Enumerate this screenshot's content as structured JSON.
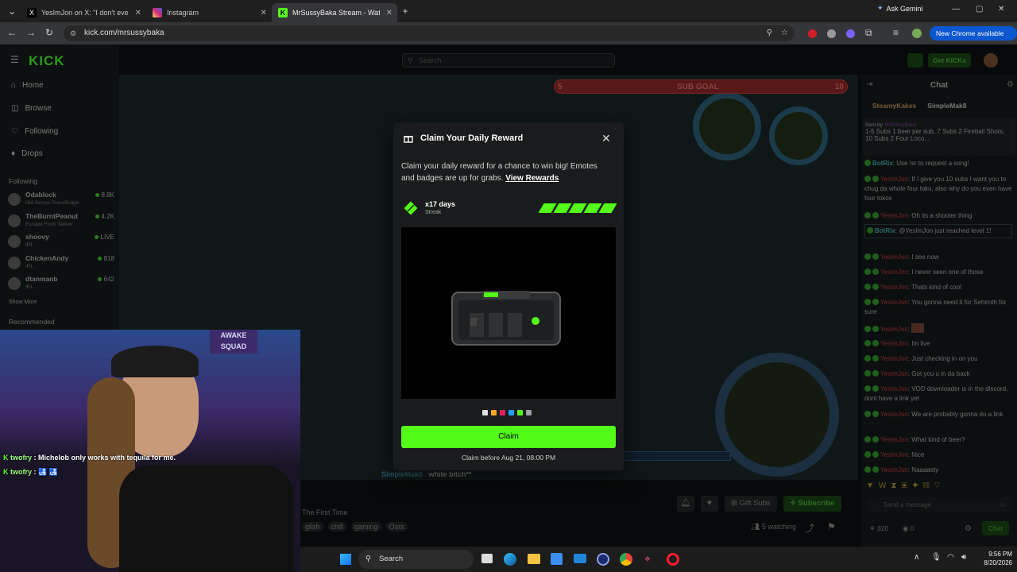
{
  "browser": {
    "tabs": [
      {
        "title": "YesImJon on X: \"I don't even be",
        "favicon": "x-icon",
        "color": "#000000"
      },
      {
        "title": "Instagram",
        "favicon": "instagram-icon",
        "color": "#d62976"
      },
      {
        "title": "MrSussyBaka Stream - Watch L",
        "favicon": "kick-icon",
        "color": "#53fc18"
      }
    ],
    "ask_gemini": "Ask Gemini",
    "url": "kick.com/mrsussybaka",
    "new_chrome": "New Chrome available"
  },
  "sidebar": {
    "logo": "KICK",
    "nav": [
      {
        "label": "Home",
        "icon": "home-icon"
      },
      {
        "label": "Browse",
        "icon": "compass-icon"
      },
      {
        "label": "Following",
        "icon": "heart-icon"
      },
      {
        "label": "Drops",
        "icon": "drops-icon"
      }
    ],
    "following_title": "Following",
    "following": [
      {
        "name": "Odablock",
        "game": "Old School RuneScape",
        "count": "8.8K"
      },
      {
        "name": "TheBurntPeanut",
        "game": "Escape From Tarkov",
        "count": "4.2K"
      },
      {
        "name": "shoovy",
        "game": "IRL",
        "count": "LIVE"
      },
      {
        "name": "ChickenAndy",
        "game": "IRL",
        "count": "818"
      },
      {
        "name": "dtanmanb",
        "game": "IRL",
        "count": "642"
      }
    ],
    "show_more": "Show More",
    "recommended": "Recommended"
  },
  "topbar": {
    "search_placeholder": "Search",
    "get_kicks": "Get KICKs"
  },
  "stream": {
    "sub_goal": {
      "label": "SUB GOAL",
      "current": "5",
      "target": "10"
    },
    "overlay_chat": [
      {
        "user": "twofry",
        "text": "Michelob only works with tequila for me."
      },
      {
        "user": "twofry",
        "text": "🛃 🛃"
      }
    ],
    "below_chat": {
      "user": "SimpleMak8",
      "text": "white bitch**"
    },
    "title_frag": "The First Time",
    "tags": [
      "glish",
      "chill",
      "gaming",
      "Osrs"
    ],
    "gift_subs": "Gift Subs",
    "subscribe": "Subscribe",
    "watching": "5 watching"
  },
  "chat": {
    "title": "Chat",
    "top_gifters": [
      "SteamyKakes",
      "SimpleMak8"
    ],
    "pinned": {
      "sent_by": "Sent by",
      "by": "MrSussyBaka",
      "text": "1-5 Subs 1 beer per sub, 7 Subs 2 Fireball Shots, 10 Subs 2 Four Loco..."
    },
    "messages": [
      {
        "user": "BotRix",
        "bot": true,
        "text": "Use !sr to request a song!"
      },
      {
        "user": "YesImJon",
        "text": "If I give you 10 subs I want you to chug da whole four loko, also why do you even have four lokos"
      },
      {
        "user": "YesImJon",
        "text": "Oh its a shooter thing"
      },
      {
        "user": "BotRix",
        "bot": true,
        "text": "@YesImJon just reached level 1!"
      },
      {
        "user": "YesImJon",
        "text": "I see now"
      },
      {
        "user": "YesImJon",
        "text": "I never seen one of those"
      },
      {
        "user": "YesImJon",
        "text": "Thats kind of cool"
      },
      {
        "user": "YesImJon",
        "text": "You gonna need it for Sehiroth for sure"
      },
      {
        "user": "YesImJon",
        "text": ""
      },
      {
        "user": "YesImJon",
        "text": "Im live"
      },
      {
        "user": "YesImJon",
        "text": "Just checking in on you"
      },
      {
        "user": "YesImJon",
        "text": "Got you u in da back"
      },
      {
        "user": "YesImJon",
        "text": "VOD downloader is in the discord, dont have a link yet"
      },
      {
        "user": "YesImJon",
        "text": "We are probably gonna do a link"
      },
      {
        "user": "YesImJon",
        "text": "What kind of beer?"
      },
      {
        "user": "YesImJon",
        "text": "Nice"
      },
      {
        "user": "YesImJon",
        "text": "Naaaasty"
      }
    ],
    "input_placeholder": "Send a message",
    "points": "320",
    "kicks": "0",
    "send": "Chat"
  },
  "modal": {
    "title": "Claim Your Daily Reward",
    "description": "Claim your daily reward for a chance to win big! Emotes and badges are up for grabs.",
    "view_rewards": "View Rewards",
    "streak_days": "x17 days",
    "streak_label": "Streak",
    "streak_bars": 5,
    "pager_colors": [
      "#e0e0e0",
      "#f5a623",
      "#e0245e",
      "#1da1f2",
      "#53fc18",
      "#9aa0a6"
    ],
    "claim": "Claim",
    "deadline": "Claim before Aug 21, 08:00 PM"
  },
  "taskbar": {
    "search": "Search",
    "time": "9:56 PM",
    "date": "8/20/2026"
  }
}
